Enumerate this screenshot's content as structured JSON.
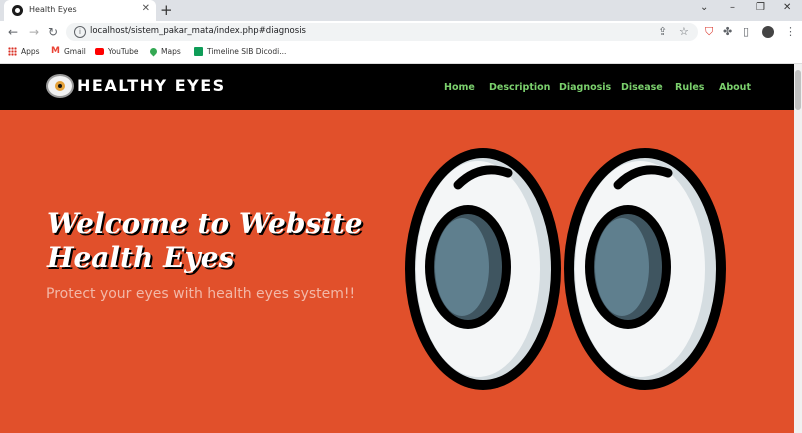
{
  "browser": {
    "tab_title": "Health Eyes",
    "tab_close": "✕",
    "new_tab": "+",
    "url": "localhost/sistem_pakar_mata/index.php#diagnosis",
    "window_controls": [
      "⌄",
      "–",
      "❐",
      "✕"
    ],
    "bookmarks": [
      {
        "label": "Apps",
        "icon": "apps-grid-icon",
        "color": "#d93025"
      },
      {
        "label": "Gmail",
        "icon": "gmail-icon",
        "color": "#ea4335"
      },
      {
        "label": "YouTube",
        "icon": "youtube-icon",
        "color": "#ff0000"
      },
      {
        "label": "Maps",
        "icon": "maps-pin-icon",
        "color": "#34a853"
      },
      {
        "label": "Timeline SIB Dicodi...",
        "icon": "sheets-icon",
        "color": "#0f9d58"
      }
    ]
  },
  "site": {
    "brand": "HEALTHY EYES",
    "menu": [
      "Home",
      "Description",
      "Diagnosis",
      "Disease",
      "Rules",
      "About"
    ],
    "headline_line1": "Welcome to Website",
    "headline_line2": "Health Eyes",
    "subtitle": "Protect your eyes with health eyes system!!",
    "colors": {
      "hero_bg": "#e1502b",
      "nav_bg": "#000000",
      "menu_text": "#7bd06d",
      "iris": "#5b7a8a"
    }
  }
}
